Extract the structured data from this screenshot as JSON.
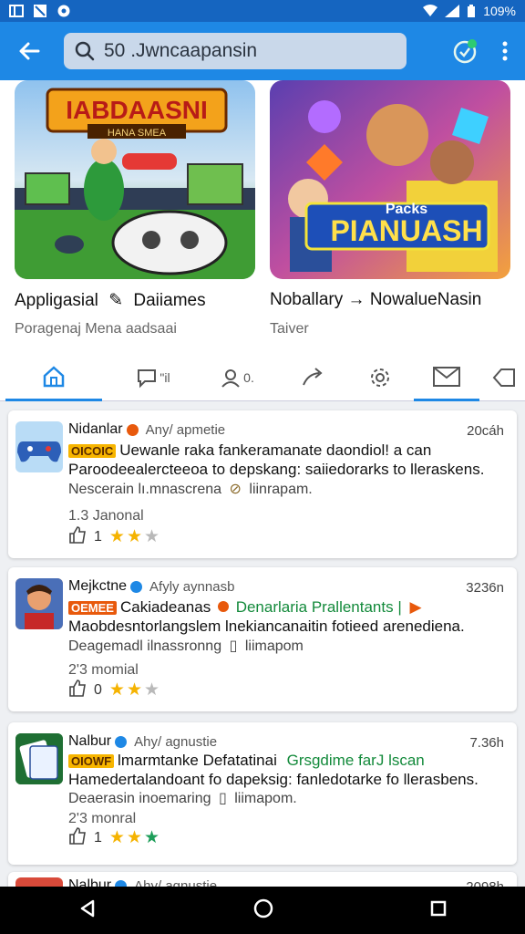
{
  "status": {
    "battery": "109%"
  },
  "search": {
    "query": "50 .Jwncaapansin"
  },
  "hero": [
    {
      "banner_title": "IABDAASNI",
      "banner_sub": "HANA SMEA",
      "title": "Appligasial",
      "title_suffix": "Daiiames",
      "subtitle": "Poragenaj Mena aadsaai"
    },
    {
      "banner_small": "Packs",
      "banner_title": "PIANUASH",
      "title": "Noballary → NowalueNasin",
      "subtitle": "Taiver"
    }
  ],
  "tabs": [
    {
      "icon": "home-icon",
      "label": ""
    },
    {
      "icon": "chat-icon",
      "label": "\"il"
    },
    {
      "icon": "profile-icon",
      "label": "0."
    },
    {
      "icon": "share-icon",
      "label": ""
    },
    {
      "icon": "gear-icon",
      "label": ""
    },
    {
      "icon": "mail-icon",
      "label": ""
    },
    {
      "icon": "tag-icon",
      "label": ""
    }
  ],
  "feed": [
    {
      "author": "Nidanlar",
      "meta": "Any/ apmetie",
      "time": "20cáh",
      "tag": "OICOIC",
      "line1": "Uewanle raka fankeramanate daondiol! a can",
      "line1_green": "",
      "line2": "Paroodeealercteeoa to depskang: saiiedorarks to lleraskens.",
      "sub": "Nescerain lı.mnascrena",
      "sub2": "liinrapam.",
      "stat": "1.3  Janonal",
      "likes": "1",
      "stars": [
        "gold",
        "gold",
        "gray"
      ]
    },
    {
      "author": "Mejkctne",
      "meta": "Afyly aynnasb",
      "time": "3236n",
      "tag": "OEMEE",
      "line1": "Cakiadeanas",
      "line1_green": "Denarlaria Prallentants |",
      "line2": "Maobdesntorlangslem lnekiancanaitin fotieed arenediena.",
      "sub": "Deagemadl ilnassronng",
      "sub2": "liimapom",
      "stat": "2'3  momial",
      "likes": "0",
      "stars": [
        "gold",
        "gold",
        "gray"
      ]
    },
    {
      "author": "Nalbur",
      "meta": "Ahy/ agnustie",
      "time": "7.36h",
      "tag": "OIOWF",
      "line1": "lmarmtanke Defatatinai",
      "line1_green": "Grsgdime farJ lscan",
      "line2": "Hamedertalandoant fo dapeksig: fanledotarke fo llerasbens.",
      "sub": "Deaerasin inoemaring",
      "sub2": "liimapom.",
      "stat": "2'3  monral",
      "likes": "1",
      "stars": [
        "gold",
        "gold",
        "green"
      ]
    },
    {
      "author": "Nalbur",
      "meta": "Ahy/ agnustie",
      "time": "2098h"
    }
  ],
  "colors": {
    "app_bar": "#1e88e5",
    "status_bar": "#1565c0",
    "accent": "#1e88e5",
    "star": "#f5b301"
  }
}
